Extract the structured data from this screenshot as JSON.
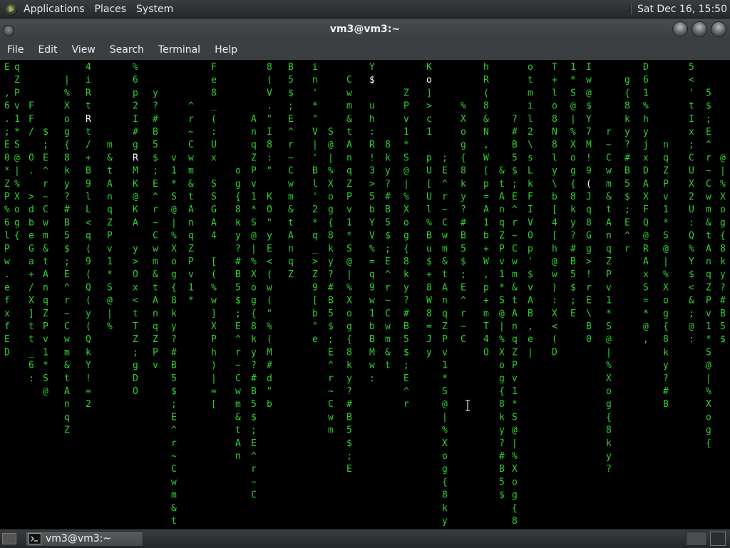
{
  "top_panel": {
    "menus": [
      "Applications",
      "Places",
      "System"
    ],
    "clock": "Sat Dec 16, 15:50"
  },
  "window": {
    "title": "vm3@vm3:~"
  },
  "menubar": [
    "File",
    "Edit",
    "View",
    "Search",
    "Terminal",
    "Help"
  ],
  "taskbar": {
    "task_label": "vm3@vm3:~"
  },
  "colors": {
    "matrix_green": "#2fd12f",
    "matrix_white": "#ffffff",
    "background": "#000000"
  },
  "terminal": {
    "program": "matrix rain",
    "cols": [
      {
        "c": "E ,6.;E0*ZP%6lPw.efxfED",
        "bright": -1
      },
      {
        "c": "   FF/ O. >dbeGa+/X]tt_6:",
        "bright": -1
      },
      {
        "c": "4iRtRt/+B9lL<q(9(Q(y(QkY!=2",
        "bright": 4
      },
      {
        "c": "%6p2I#gRMK@KA y>Ox<tTZ;gDO",
        "bright": 7
      },
      {
        "c": "Fe8_(:Ux SSGA4 [(%w]XPh)|=[",
        "bright": -1
      },
      {
        "c": "8(V.\"I8:\" KO\"yE<(w(\"%(M#d\"b",
        "bright": -1
      },
      {
        "c": "in'*\"V|'Bl'2*q_>Z9[b\"e",
        "bright": -1
      },
      {
        "c": "Y$ uh:R!3>5bYV%=q9w1bBMw:",
        "bright": 1
      },
      {
        "c": "Ko]>c1 pU[Ul%Bu$+8W8=Jy",
        "bright": 1
      },
      {
        "c": "hR(8&N,W[p=A1b+W,p+mT4O",
        "bright": -1
      },
      {
        "c": "otmil2\\sLkFIVOp'$vAB,e|",
        "bright": -1
      },
      {
        "c": "T+lo8N8ly\\b[4[h@w):X<(D",
        "bright": -1
      },
      {
        "c": "Iw@$Y7M!9(Jq8Gg>!rE\\B0",
        "bright": 9
      },
      {
        "c": "D61%hyjxDAXFQ@RAxS=*@,",
        "bright": -1
      },
      {
        "c": "5<'tIx;CUX2U:Q%Y$<&;@:",
        "bright": -1
      }
    ]
  }
}
